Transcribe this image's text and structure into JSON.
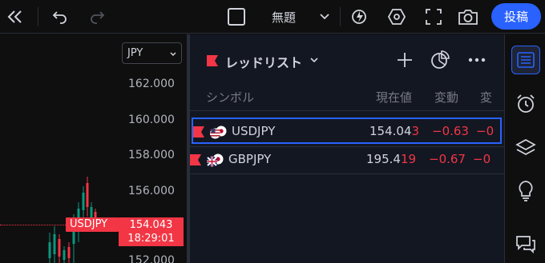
{
  "toolbar": {
    "title": "無題",
    "post_label": "投稿"
  },
  "chart": {
    "currency": "JPY",
    "price_ticks": [
      "162.000",
      "160.000",
      "158.000",
      "156.000",
      "152.000"
    ],
    "symbol_tag": "USDJPY",
    "last_price": "154.043",
    "countdown": "18:29:01",
    "accent_color": "#f23645"
  },
  "watchlist": {
    "title": "レッドリスト",
    "columns": {
      "symbol": "シンボル",
      "last": "現在値",
      "change": "変動",
      "change_pct": "変"
    },
    "rows": [
      {
        "symbol": "USDJPY",
        "last_main": "154.04",
        "last_tail": "3",
        "change": "−0.63",
        "change_pct": "−0",
        "selected": true
      },
      {
        "symbol": "GBPJPY",
        "last_main": "195.4",
        "last_tail": "19",
        "change": "−0.67",
        "change_pct": "−0",
        "selected": false
      }
    ]
  },
  "colors": {
    "accent": "#2962ff",
    "negative": "#f23645",
    "positive": "#089981"
  }
}
